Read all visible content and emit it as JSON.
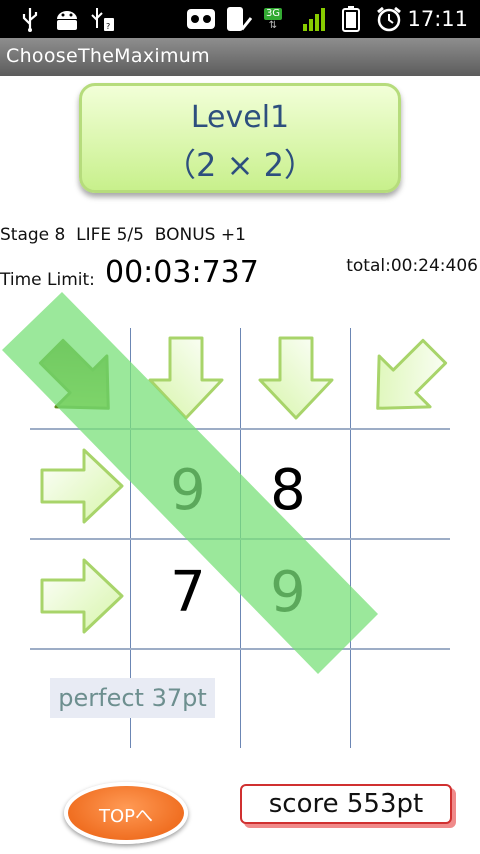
{
  "status_bar": {
    "time": "17:11",
    "network_label": "3G",
    "icons": [
      "usb-icon",
      "android-debug-icon",
      "usb-storage-icon",
      "voicemail-icon",
      "phone-check-icon",
      "network-3g-icon",
      "signal-icon",
      "battery-icon",
      "alarm-icon"
    ]
  },
  "app": {
    "title": "ChooseTheMaximum"
  },
  "level": {
    "line1": "Level1",
    "line2": "（2 × 2）"
  },
  "game_info": {
    "stage": "Stage 8",
    "life": "LIFE 5/5",
    "bonus": "BONUS +1",
    "time_limit_label": "Time Limit:",
    "time_limit_value": "00:03:737",
    "total": "total:00:24:406"
  },
  "grid": {
    "cells": [
      [
        "9",
        "8"
      ],
      [
        "7",
        "9"
      ]
    ],
    "arrows": [
      "diagonal-down-right",
      "down-col-1",
      "down-col-2",
      "diagonal-down-left",
      "right-row-1",
      "right-row-2"
    ],
    "selected_arrow": "diagonal-down-right"
  },
  "result": {
    "perfect": "perfect 37pt"
  },
  "footer": {
    "top_button": "TOPへ",
    "score": "score 553pt"
  },
  "colors": {
    "highlight": "#8ee68e",
    "arrow_fill": "#e8ffc8",
    "arrow_selected": "#6f9a22",
    "level_box": "#d8f7a8",
    "top_button": "#f07a2c",
    "score_border": "#d03030"
  }
}
